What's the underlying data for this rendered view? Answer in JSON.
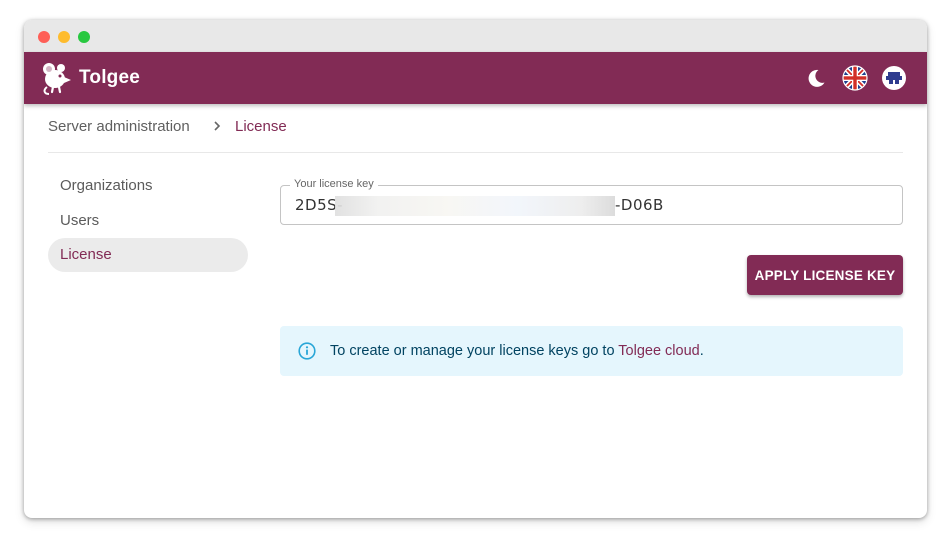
{
  "colors": {
    "brand": "#822b55",
    "alert_bg": "#e5f6fd",
    "info_icon": "#29a6d7"
  },
  "app": {
    "name": "Tolgee"
  },
  "header": {
    "icons": [
      "mouse-logo-icon",
      "moon-icon",
      "uk-flag-icon",
      "user-avatar-icon"
    ]
  },
  "breadcrumb": {
    "parent": "Server administration",
    "current": "License"
  },
  "sidebar": {
    "items": [
      {
        "label": "Organizations",
        "active": false
      },
      {
        "label": "Users",
        "active": false
      },
      {
        "label": "License",
        "active": true
      }
    ]
  },
  "license_field": {
    "label": "Your license key",
    "value_start": "2D5S-",
    "value_end": "-D06B"
  },
  "apply_button": {
    "label": "APPLY LICENSE KEY"
  },
  "info_alert": {
    "text": "To create or manage your license keys go to ",
    "link_text": "Tolgee cloud",
    "suffix": "."
  }
}
